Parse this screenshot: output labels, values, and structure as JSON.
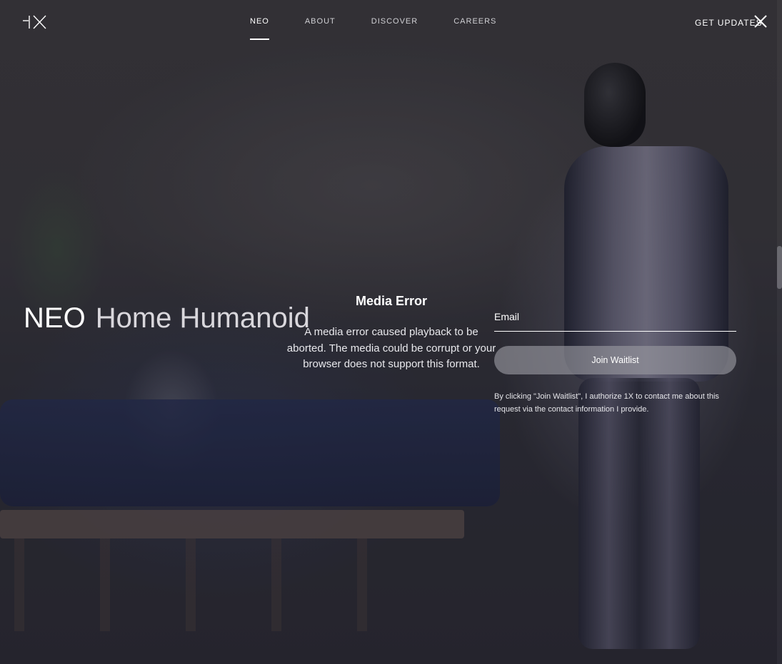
{
  "header": {
    "logo_text": "1X",
    "nav": [
      {
        "label": "NEO",
        "active": true
      },
      {
        "label": "ABOUT",
        "active": false
      },
      {
        "label": "DISCOVER",
        "active": false
      },
      {
        "label": "CAREERS",
        "active": false
      }
    ],
    "get_updates_label": "GET UPDATES",
    "close_icon": "close-icon"
  },
  "hero": {
    "title_strong": "NEO",
    "title_light": "Home Humanoid"
  },
  "media_error": {
    "title": "Media Error",
    "message": "A media error caused playback to be aborted. The media could be corrupt or your browser does not support this format."
  },
  "form": {
    "email_placeholder": "Email",
    "email_value": "",
    "join_label": "Join Waitlist",
    "disclaimer": "By clicking \"Join Waitlist\", I authorize 1X to contact me about this request via the contact information I provide."
  },
  "colors": {
    "text": "#ffffff",
    "button_bg": "#96969e",
    "background": "#2a2a32"
  }
}
